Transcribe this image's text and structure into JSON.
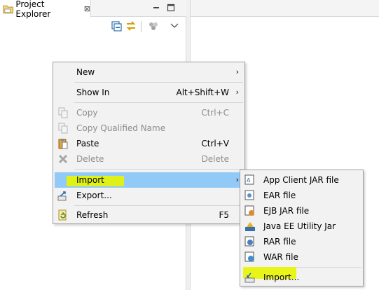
{
  "view": {
    "title": "Project Explorer",
    "close_glyph": "⊠",
    "icons": [
      "folder-icon",
      "minimize-icon",
      "maximize-icon",
      "collapse-all-icon",
      "link-with-editor-icon",
      "filter-icon",
      "view-menu-icon"
    ]
  },
  "context_menu": {
    "items": {
      "new": {
        "label": "New",
        "arrow": "›"
      },
      "show_in": {
        "label": "Show In",
        "accel": "Alt+Shift+W",
        "arrow": "›"
      },
      "copy": {
        "label": "Copy",
        "accel": "Ctrl+C"
      },
      "copy_qualified": {
        "label": "Copy Qualified Name"
      },
      "paste": {
        "label": "Paste",
        "accel": "Ctrl+V"
      },
      "delete": {
        "label": "Delete",
        "accel": "Delete"
      },
      "import": {
        "label": "Import",
        "arrow": "›"
      },
      "export": {
        "label": "Export..."
      },
      "refresh": {
        "label": "Refresh",
        "accel": "F5"
      }
    }
  },
  "import_submenu": {
    "items": {
      "app_client": {
        "label": "App Client JAR file"
      },
      "ear": {
        "label": "EAR file"
      },
      "ejb": {
        "label": "EJB JAR file"
      },
      "java_ee_utility": {
        "label": "Java EE Utility Jar"
      },
      "rar": {
        "label": "RAR file"
      },
      "war": {
        "label": "WAR file"
      },
      "import_more": {
        "label": "Import..."
      }
    }
  },
  "colors": {
    "selection": "#91c9f7",
    "highlighter": "#e8f500",
    "menu_bg": "#f2f2f2"
  }
}
